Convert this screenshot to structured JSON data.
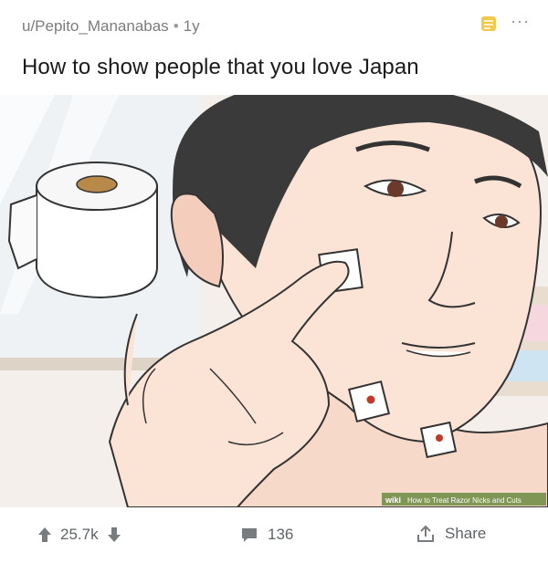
{
  "post": {
    "author": "u/Pepito_Mananabas",
    "separator": "•",
    "age": "1y",
    "title": "How to show people that you love Japan",
    "image": {
      "watermark_brand": "wiki",
      "watermark_text": "How to Treat Razor Nicks and Cuts"
    }
  },
  "icons": {
    "award": "award-icon",
    "more": "more-options-icon",
    "upvote": "upvote-arrow-icon",
    "downvote": "downvote-arrow-icon",
    "comment": "comment-bubble-icon",
    "share": "share-icon"
  },
  "actions": {
    "score": "25.7k",
    "comment_count": "136",
    "share_label": "Share",
    "more_glyph": "···"
  },
  "colors": {
    "award": "#f2c94c",
    "icon_gray": "#787c7e",
    "text_muted": "#7c7c7c",
    "title": "#1a1a1b",
    "blood_spot": "#c0392b"
  }
}
